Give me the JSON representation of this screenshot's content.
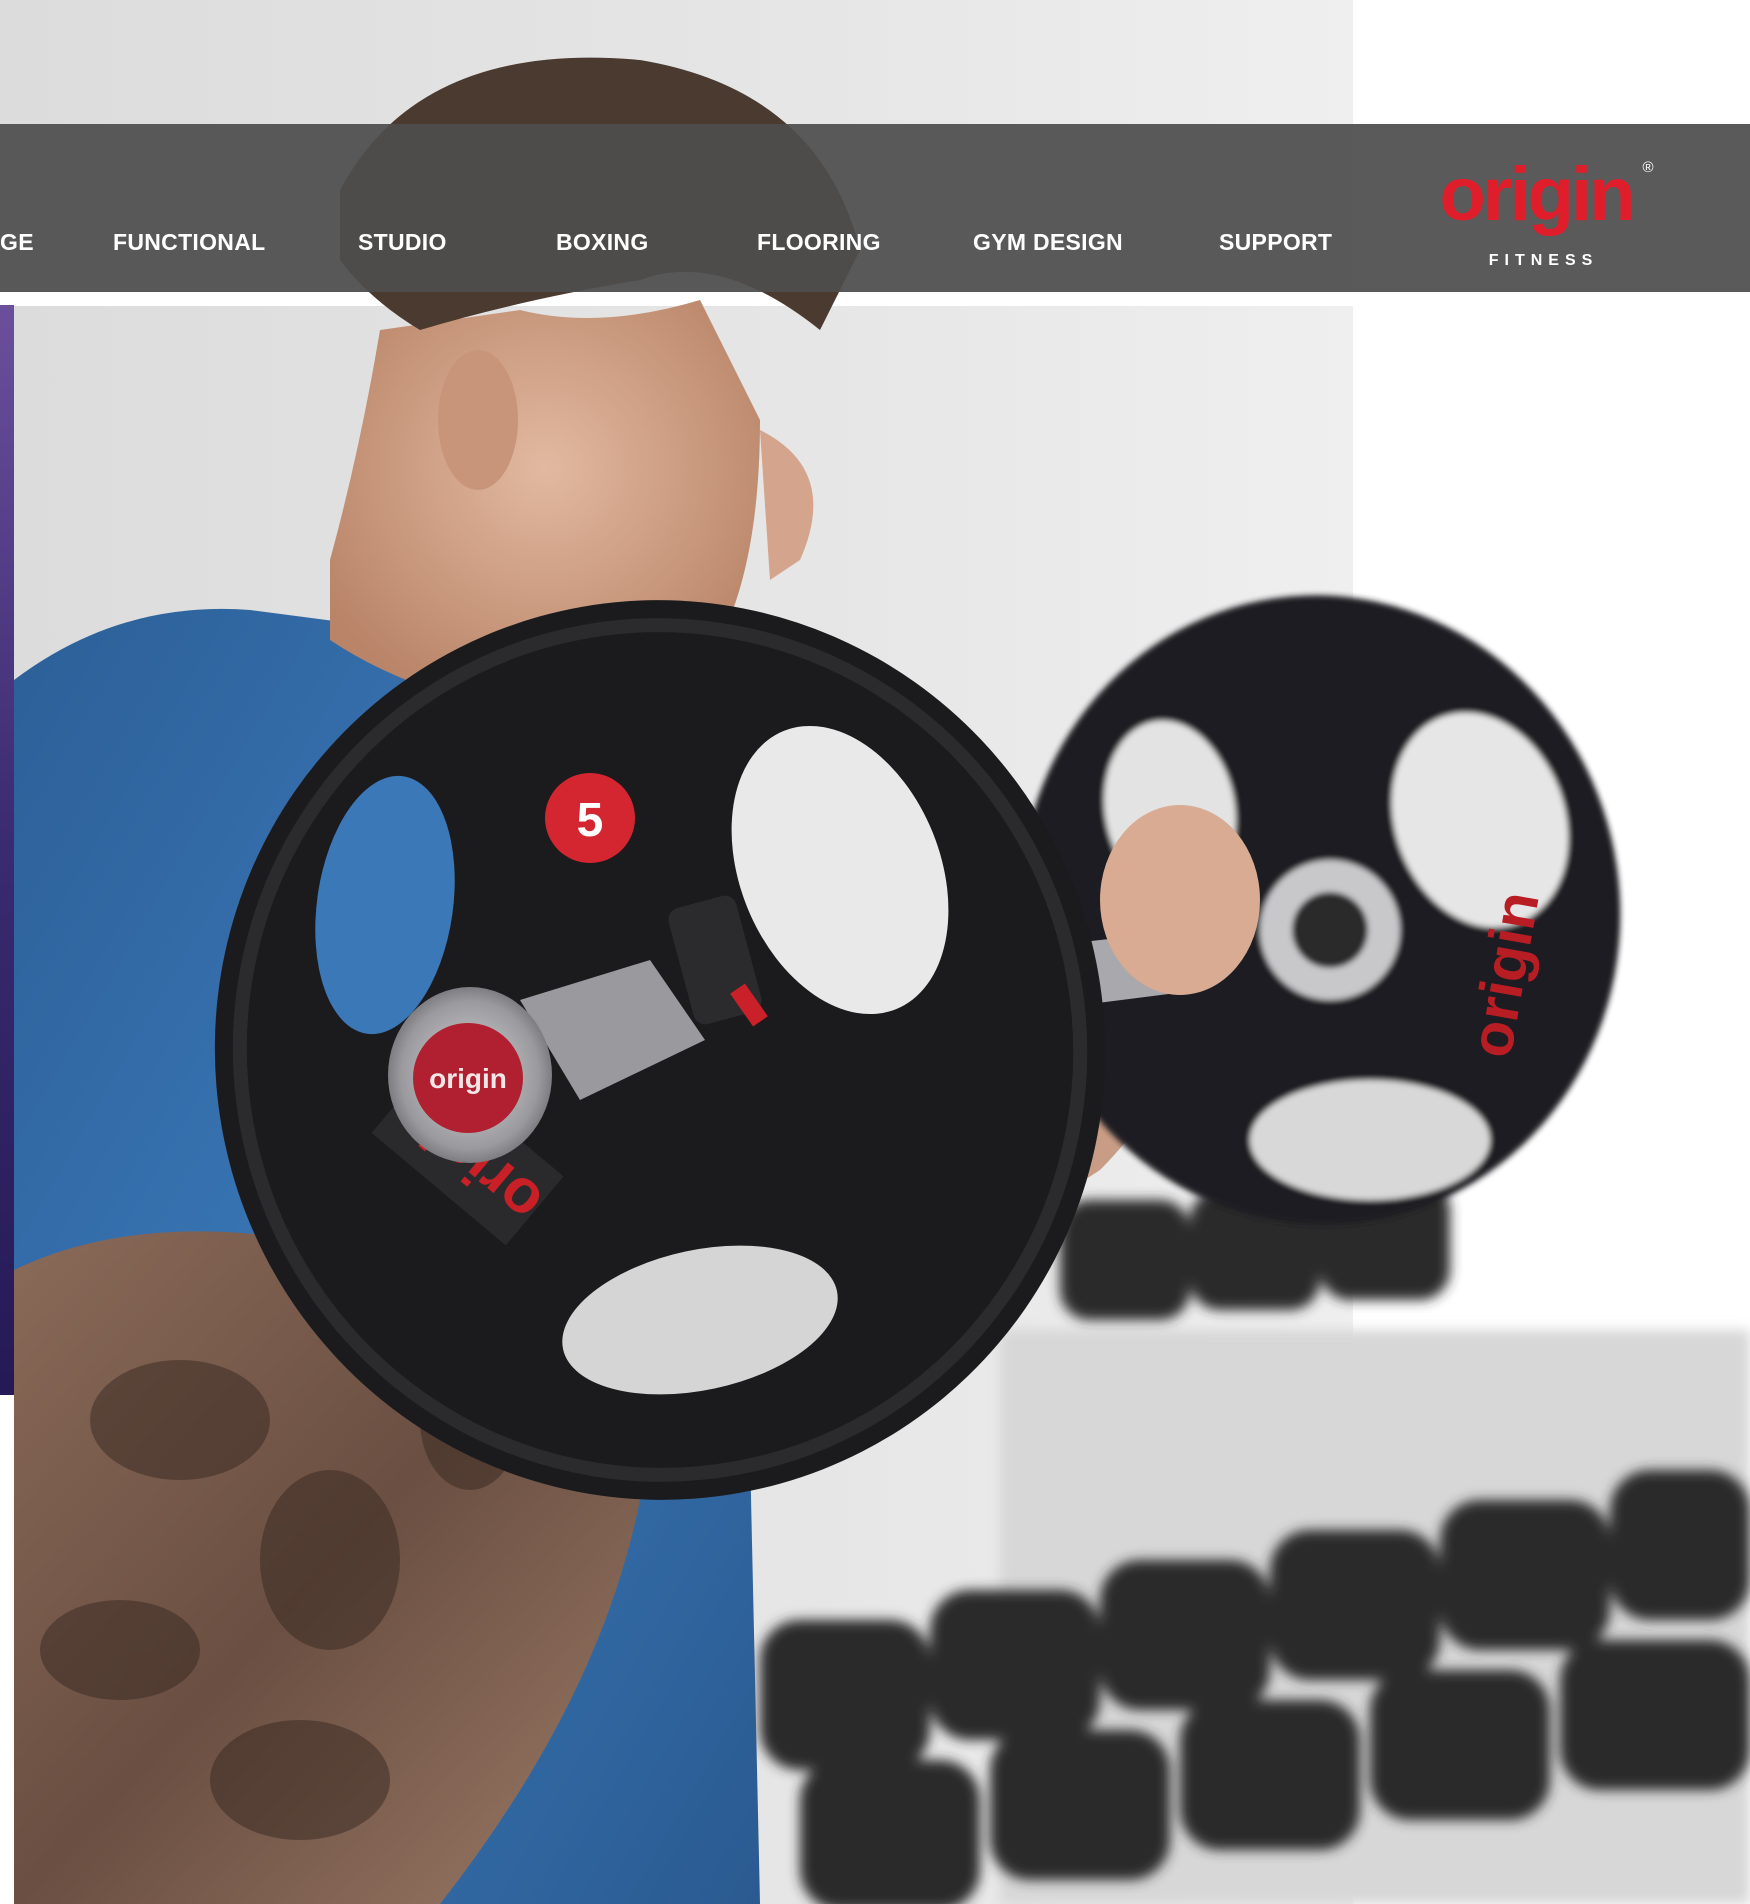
{
  "nav": {
    "items": [
      {
        "label": "GE"
      },
      {
        "label": "FUNCTIONAL"
      },
      {
        "label": "STUDIO"
      },
      {
        "label": "BOXING"
      },
      {
        "label": "FLOORING"
      },
      {
        "label": "GYM DESIGN"
      },
      {
        "label": "SUPPORT"
      }
    ]
  },
  "brand": {
    "name": "origin",
    "tagline": "FITNESS",
    "registered": "®",
    "color": "#e01e2b"
  },
  "hero": {
    "plate_number": "5",
    "plate_brand": "origin",
    "colors": {
      "shirt": "#2f6aa8",
      "plate": "#1b1b1d",
      "accent_strip": "#4a3584",
      "background": "#e4e4e4"
    }
  }
}
